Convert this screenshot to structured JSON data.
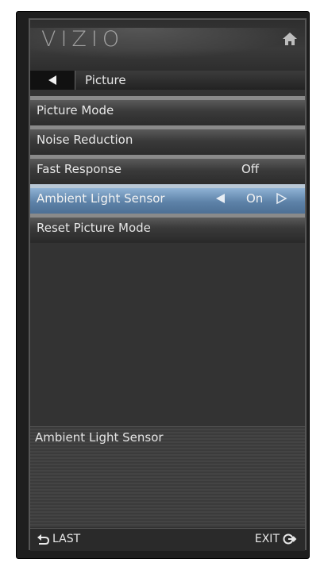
{
  "header": {
    "logo": "VIZIO",
    "home_icon": "home-icon"
  },
  "breadcrumb": {
    "back_icon": "triangle-left-icon",
    "title": "Picture"
  },
  "menu": {
    "items": [
      {
        "label": "Picture Mode",
        "value": ""
      },
      {
        "label": "Noise Reduction",
        "value": ""
      },
      {
        "label": "Fast Response",
        "value": "Off"
      },
      {
        "label": "Ambient Light Sensor",
        "value": "On",
        "selected": true
      },
      {
        "label": "Reset Picture Mode",
        "value": ""
      }
    ]
  },
  "description": {
    "title": "Ambient Light Sensor"
  },
  "footer": {
    "last_label": "LAST",
    "exit_label": "EXIT",
    "last_icon": "return-arrow-icon",
    "exit_icon": "exit-icon"
  },
  "colors": {
    "selected_row": "#5d82a8",
    "panel": "#333333"
  }
}
